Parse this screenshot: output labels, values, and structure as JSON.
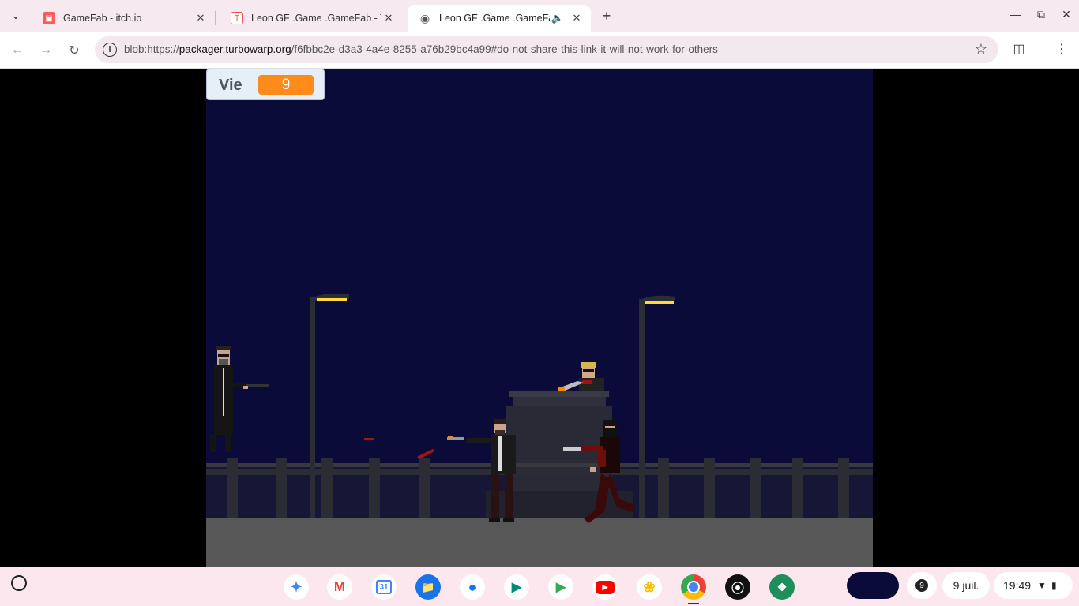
{
  "tabs": [
    {
      "title": "GameFab - itch.io",
      "favicon": "itch-io-icon",
      "active": false
    },
    {
      "title": "Leon GF .Game .GameFab - Tu",
      "favicon": "turbowarp-icon",
      "active": false
    },
    {
      "title": "Leon GF .Game .GameFab",
      "favicon": "globe-icon",
      "active": true,
      "audio": true
    }
  ],
  "toolbar": {
    "url_prefix": "blob:https://",
    "url_host": "packager.turbowarp.org",
    "url_rest": "/f6fbbc2e-d3a3-4a4e-8255-a76b29bc4a99#do-not-share-this-link-it-will-not-work-for-others"
  },
  "game": {
    "monitor_label": "Vie",
    "monitor_value": "9"
  },
  "shelf": {
    "apps": [
      "gemini-icon",
      "gmail-icon",
      "calendar-icon",
      "files-icon",
      "messages-icon",
      "meet-icon",
      "play-store-icon",
      "youtube-icon",
      "photos-icon",
      "chrome-icon",
      "podcasts-icon",
      "app-icon"
    ],
    "calendar_day": "31",
    "notification_count": "9",
    "date": "9 juil.",
    "time": "19:49"
  },
  "colors": {
    "sky": "#0b0b3a",
    "monitor_value_bg": "#ff8c1a",
    "ground": "#555555"
  }
}
